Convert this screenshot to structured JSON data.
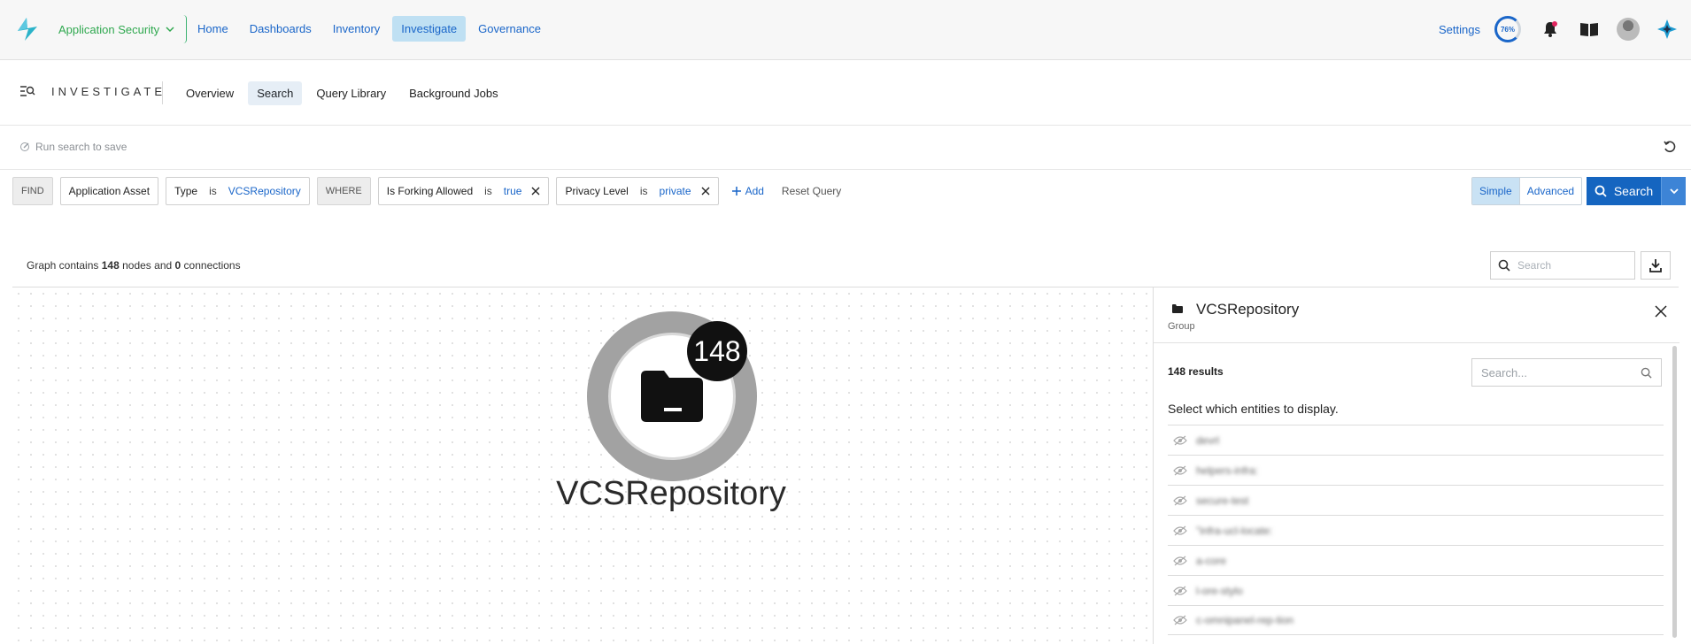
{
  "topnav": {
    "app_selector": "Application Security",
    "items": [
      {
        "label": "Home",
        "active": false
      },
      {
        "label": "Dashboards",
        "active": false
      },
      {
        "label": "Inventory",
        "active": false
      },
      {
        "label": "Investigate",
        "active": true
      },
      {
        "label": "Governance",
        "active": false
      }
    ],
    "settings_label": "Settings",
    "progress_percent": "76%",
    "accent_color": "#1a66c9"
  },
  "subnav": {
    "brand": "INVESTIGATE",
    "tabs": [
      {
        "label": "Overview",
        "active": false
      },
      {
        "label": "Search",
        "active": true
      },
      {
        "label": "Query Library",
        "active": false
      },
      {
        "label": "Background Jobs",
        "active": false
      }
    ]
  },
  "save_row": {
    "text": "Run search to save"
  },
  "query": {
    "find_keyword": "FIND",
    "find_value": "Application Asset",
    "type_field": "Type",
    "type_op": "is",
    "type_value": "VCSRepository",
    "where_keyword": "WHERE",
    "filters": [
      {
        "field": "Is Forking Allowed",
        "op": "is",
        "value": "true"
      },
      {
        "field": "Privacy Level",
        "op": "is",
        "value": "private"
      }
    ],
    "add_label": "Add",
    "reset_label": "Reset Query",
    "mode_simple": "Simple",
    "mode_advanced": "Advanced",
    "search_label": "Search"
  },
  "graph": {
    "info_prefix": "Graph contains",
    "nodes": "148",
    "info_mid": "nodes and",
    "connections": "0",
    "info_suffix": "connections",
    "search_placeholder": "Search",
    "node_label": "VCSRepository",
    "node_count": "148"
  },
  "panel": {
    "title": "VCSRepository",
    "subtitle": "Group",
    "results": "148 results",
    "search_placeholder": "Search...",
    "instruction": "Select which entities to display.",
    "items": [
      "devrl",
      "helpers-infra:",
      "secure-test",
      "\"infra-ucl-locate:",
      "a-core",
      "l-ore-stylo",
      "c-omnipanel-rep-tion"
    ]
  }
}
